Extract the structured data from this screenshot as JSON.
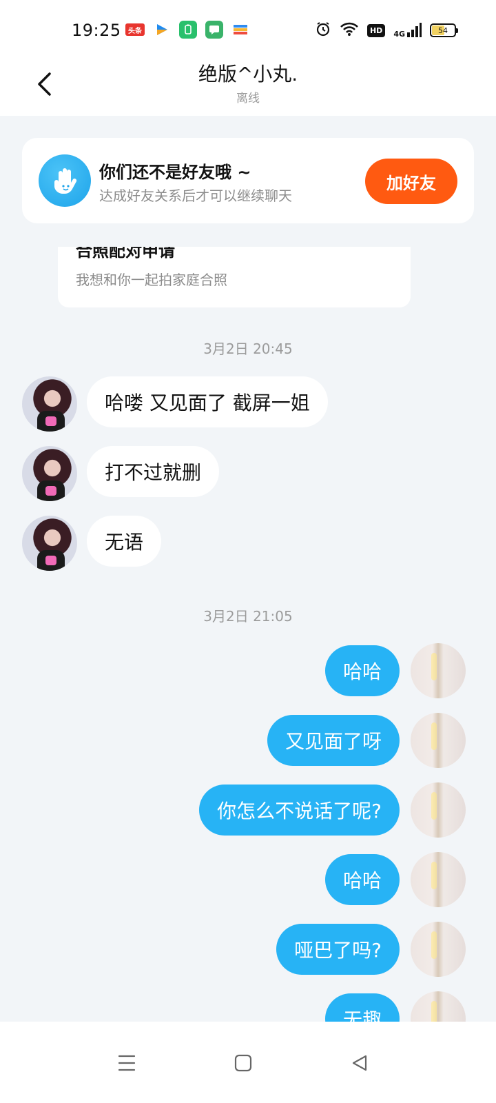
{
  "status_bar": {
    "time": "19:25",
    "toutiao_label": "头条",
    "network": "4G",
    "hd": "HD",
    "battery": "54",
    "battery_level": 0.54
  },
  "header": {
    "title": "绝版^小丸.",
    "subtitle": "离线"
  },
  "friend_banner": {
    "title": "你们还不是好友哦 ~",
    "subtitle": "达成好友关系后才可以继续聊天",
    "button_label": "加好友"
  },
  "request_card": {
    "title": "合照配对申请",
    "subtitle": "我想和你一起拍家庭合照"
  },
  "timestamps": [
    "3月2日 20:45",
    "3月2日 21:05"
  ],
  "incoming_messages": [
    "哈喽 又见面了 截屏一姐",
    "打不过就删",
    "无语"
  ],
  "outgoing_messages": [
    "哈哈",
    "又见面了呀",
    "你怎么不说话了呢?",
    "哈哈",
    "哑巴了吗?",
    "无趣"
  ],
  "colors": {
    "accent_blue": "#27b3f5",
    "add_friend_orange": "#ff5a11",
    "background": "#f2f5f8"
  },
  "icons": {
    "back": "chevron-left-icon",
    "banner": "waving-hand-icon",
    "nav_menu": "menu-icon",
    "nav_home": "home-square-icon",
    "nav_back": "triangle-back-icon"
  }
}
